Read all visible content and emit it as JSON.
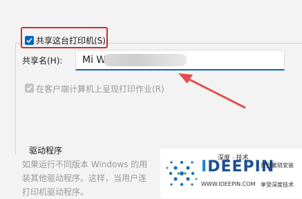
{
  "share": {
    "checkbox_label": "共享这台打印机(S)",
    "checked": true
  },
  "share_name": {
    "label": "共享名(H):",
    "value": "Mi W"
  },
  "render_jobs": {
    "label": "在客户端计算机上呈现打印作业(R)",
    "checked": true,
    "disabled": true
  },
  "drivers": {
    "heading": "驱动程序",
    "lines": [
      "如果运行不同版本 Windows 的用",
      "装其他驱动程序。这样，当用户连",
      "打印机驱动程序。"
    ]
  },
  "watermark": {
    "top_text": "深度 · 技术",
    "brand_a": "I",
    "brand_b": "DEEPIN",
    "url": "WWW.IDEEPIN.COM",
    "right_line1": "告别繁琐安装",
    "right_line2": "享受深度技术"
  },
  "colors": {
    "accent": "#0067c0",
    "highlight_box": "#d7282d",
    "arrow": "#e05050"
  }
}
